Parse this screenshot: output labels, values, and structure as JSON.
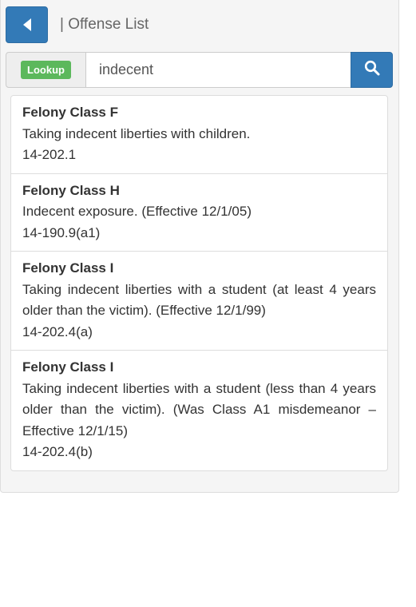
{
  "header": {
    "title": "| Offense List",
    "back_icon": "chevron-left-icon"
  },
  "search": {
    "badge": "Lookup",
    "value": "indecent",
    "button_icon": "search-icon"
  },
  "colors": {
    "primary": "#337ab7",
    "success": "#5cb85c"
  },
  "results": [
    {
      "class": "Felony Class F",
      "description": "Taking indecent liberties with children.",
      "code": "14-202.1"
    },
    {
      "class": "Felony Class H",
      "description": "Indecent exposure. (Effective 12/1/05)",
      "code": "14-190.9(a1)"
    },
    {
      "class": "Felony Class I",
      "description": "Taking indecent liberties with a student (at least 4 years older than the victim). (Effective 12/1/99)",
      "code": "14-202.4(a)"
    },
    {
      "class": "Felony Class I",
      "description": "Taking indecent liberties with a student (less than 4 years older than the victim). (Was Class A1 misdemeanor – Effective 12/1/15)",
      "code": "14-202.4(b)"
    }
  ]
}
